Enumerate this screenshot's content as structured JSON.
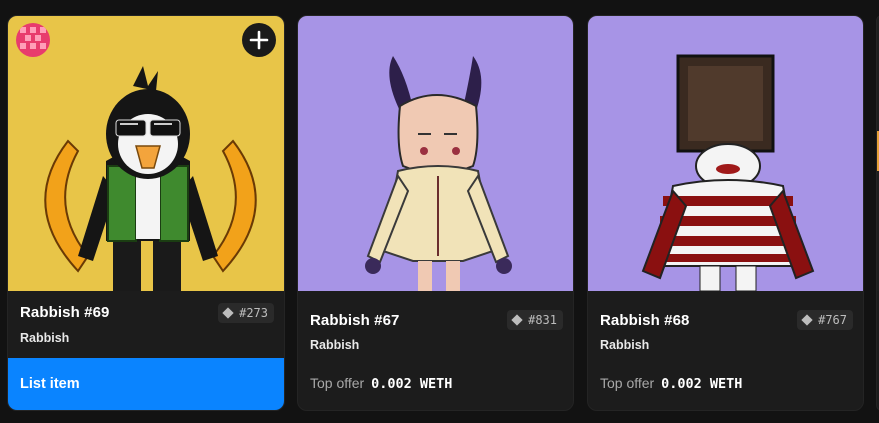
{
  "cards": [
    {
      "name": "Rabbish #69",
      "collection": "Rabbish",
      "rank": "#273",
      "action_label": "List item",
      "art_bg": "#e8c548"
    },
    {
      "name": "Rabbish #67",
      "collection": "Rabbish",
      "rank": "#831",
      "offer_label": "Top offer",
      "offer_amount": "0.002 WETH",
      "art_bg": "#a794e6"
    },
    {
      "name": "Rabbish #68",
      "collection": "Rabbish",
      "rank": "#767",
      "offer_label": "Top offer",
      "offer_amount": "0.002 WETH",
      "art_bg": "#a794e6"
    }
  ],
  "icons": {
    "add": "plus-icon",
    "owner": "avatar-icon",
    "rarity": "diamond-icon"
  },
  "colors": {
    "accent": "#0a84ff",
    "card_bg": "#1c1c1c",
    "page_bg": "#121212"
  }
}
